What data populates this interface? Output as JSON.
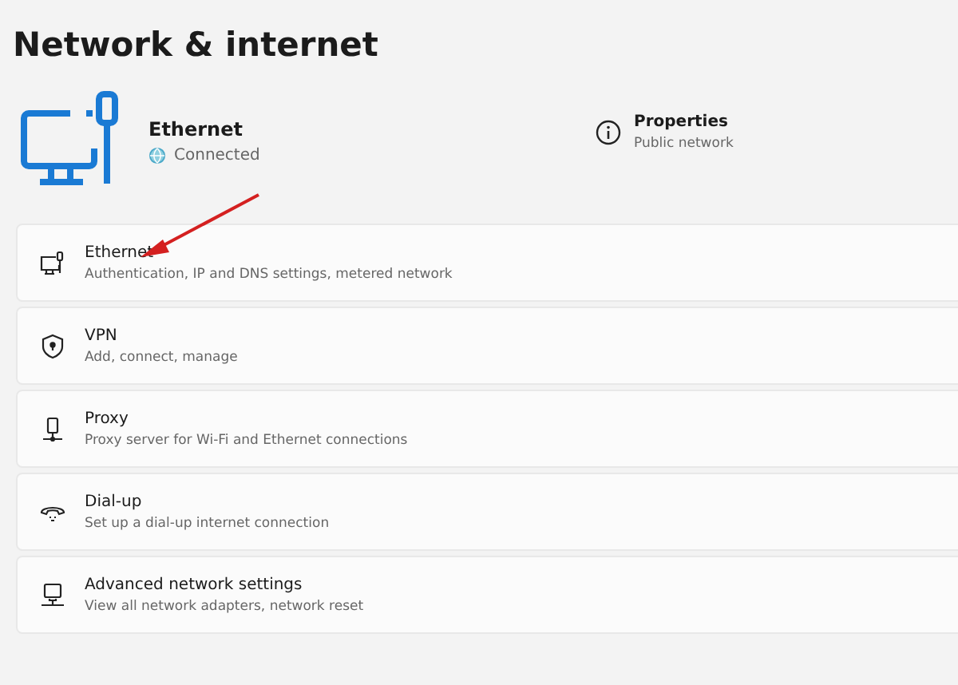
{
  "page_title": "Network & internet",
  "connection": {
    "name": "Ethernet",
    "status": "Connected"
  },
  "properties": {
    "title": "Properties",
    "subtitle": "Public network"
  },
  "settings": [
    {
      "kind": "ethernet",
      "title": "Ethernet",
      "subtitle": "Authentication, IP and DNS settings, metered network"
    },
    {
      "kind": "vpn",
      "title": "VPN",
      "subtitle": "Add, connect, manage"
    },
    {
      "kind": "proxy",
      "title": "Proxy",
      "subtitle": "Proxy server for Wi-Fi and Ethernet connections"
    },
    {
      "kind": "dialup",
      "title": "Dial-up",
      "subtitle": "Set up a dial-up internet connection"
    },
    {
      "kind": "advanced",
      "title": "Advanced network settings",
      "subtitle": "View all network adapters, network reset"
    }
  ]
}
